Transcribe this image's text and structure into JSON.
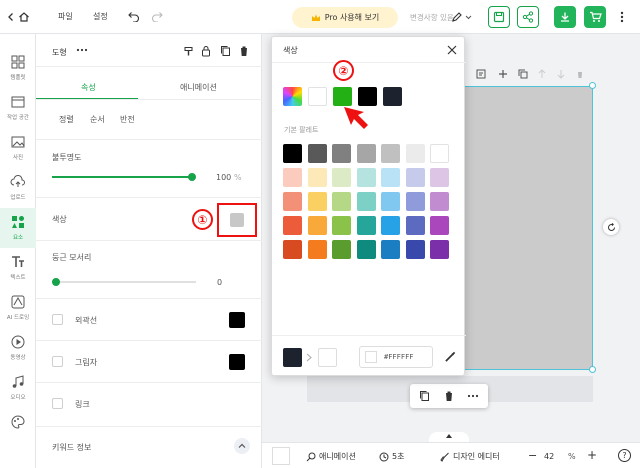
{
  "toolbar": {
    "file_label": "파일",
    "settings_label": "설정",
    "pro_label": "Pro 사용해 보기",
    "saved_status": "변경사항 있음"
  },
  "rail": {
    "items": [
      {
        "label": "템플릿",
        "icon": "template-icon"
      },
      {
        "label": "작업 공간",
        "icon": "workspace-icon"
      },
      {
        "label": "사진",
        "icon": "photo-icon"
      },
      {
        "label": "업로드",
        "icon": "upload-icon"
      },
      {
        "label": "요소",
        "icon": "elements-icon",
        "active": true
      },
      {
        "label": "텍스트",
        "icon": "text-icon"
      },
      {
        "label": "AI 드로잉",
        "icon": "ai-drawing-icon"
      },
      {
        "label": "동영상",
        "icon": "video-icon"
      },
      {
        "label": "오디오",
        "icon": "audio-icon"
      },
      {
        "label": "",
        "icon": "palette-icon"
      }
    ]
  },
  "panel": {
    "title": "도형",
    "tab_properties": "속성",
    "tab_animation": "애니메이션",
    "sub_align": "정렬",
    "sub_order": "순서",
    "sub_flip": "반전",
    "opacity_label": "불투명도",
    "opacity_value": "100",
    "opacity_unit": "%",
    "opacity_level": 1.0,
    "color_label": "색상",
    "radius_label": "둥근 모서리",
    "radius_value": "0",
    "radius_level": 0.0,
    "outline_label": "외곽선",
    "shadow_label": "그림자",
    "link_label": "링크",
    "keyword_label": "키워드 정보"
  },
  "annotations": {
    "one": "①",
    "two": "②"
  },
  "color_popup": {
    "title": "색상",
    "palette_title": "기본 팔레트",
    "recent_colors": [
      "#ffffff",
      "#22b014",
      "#000000",
      "#1c232e"
    ],
    "palette": [
      [
        "#000000",
        "#595959",
        "#808080",
        "#a6a6a6",
        "#c0c0c0",
        "#ebebeb",
        "#ffffff"
      ],
      [
        "#fbcbbd",
        "#fde8b8",
        "#dcebc6",
        "#b5e4e0",
        "#b9e2f7",
        "#c6cbec",
        "#ddc5e6"
      ],
      [
        "#f39178",
        "#fbd063",
        "#b4d886",
        "#7cd0c5",
        "#80c8f0",
        "#909bdc",
        "#c28dd0"
      ],
      [
        "#ec5c3a",
        "#f9a93a",
        "#8bc34a",
        "#26a69a",
        "#28a2e6",
        "#5c6bc0",
        "#ab47bc"
      ],
      [
        "#d84a1f",
        "#f57c1e",
        "#5a9d2e",
        "#0e8b7e",
        "#1b7ec2",
        "#3949ab",
        "#7b2fa8"
      ]
    ],
    "current_color": "#1c232e",
    "new_color": "#ffffff",
    "hex_value": "#FFFFFF"
  },
  "bottombar": {
    "animation_label": "애니메이션",
    "duration_label": "5초",
    "design_editor_label": "디자인 에디터",
    "zoom_value": "42",
    "zoom_unit": "%"
  }
}
